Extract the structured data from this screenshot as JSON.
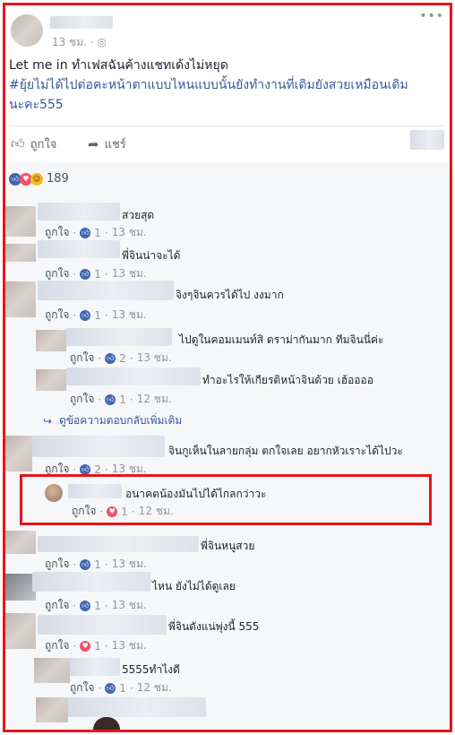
{
  "post": {
    "time": "13 ชม.",
    "privacy_icon": "globe-icon",
    "text_line1": "Let me in ทำเฟสฉันค้างแชทเด้งไม่หยุด",
    "hashtag_line": "#ยุ้ยไม่ได้ไปต่อคะหน้าตาแบบไหนแบบนั้นยังทำงานที่เดิมยังสวยเหมือนเดิม",
    "hashtag_line2": "นะคะ555",
    "like_label": "ถูกใจ",
    "share_label": "แชร์",
    "reaction_count": "189"
  },
  "comments": [
    {
      "text": "สวยสุด",
      "like": "ถูกใจ",
      "reaction": "like",
      "count": "1",
      "time": "13 ชม."
    },
    {
      "text": "พี่จินน่าจะได้",
      "like": "ถูกใจ",
      "reaction": "like",
      "count": "1",
      "time": "13 ชม."
    },
    {
      "text": "จิงๆจินควรได้ไป งงมาก",
      "like": "ถูกใจ",
      "reaction": "like",
      "count": "1",
      "time": "13 ชม."
    },
    {
      "text": "ไปดูในคอมเมนท์สิ ดราม่ากันมาก ทีมจินนี่ค่ะ",
      "like": "ถูกใจ",
      "reaction": "like",
      "count": "2",
      "time": "13 ชม."
    },
    {
      "text": "ทำอะไรให้เกียรติหน้าจินด้วย เฮ้ออออ",
      "like": "ถูกใจ",
      "reaction": "like",
      "count": "1",
      "time": "12 ชม."
    },
    {
      "text": "จินกูเห็นในลายกลุ่ม ตกใจเลย อยากหัวเราะได้ไปวะ",
      "like": "ถูกใจ",
      "reaction": "like",
      "count": "2",
      "time": "13 ชม."
    },
    {
      "text": "อนาคตน้องมันไปได้ไกลกว่าวะ",
      "like": "ถูกใจ",
      "reaction": "love",
      "count": "1",
      "time": "12 ชม."
    },
    {
      "text": "พี่จินหนูสวย",
      "like": "ถูกใจ",
      "reaction": "like",
      "count": "1",
      "time": "13 ชม."
    },
    {
      "text": "ไหน ยังไม่ได้ดูเลย",
      "like": "ถูกใจ",
      "reaction": "like",
      "count": "1",
      "time": "13 ชม."
    },
    {
      "text": "พี่จินดังแน่พุ่งนี้ 555",
      "like": "ถูกใจ",
      "reaction": "love",
      "count": "1",
      "time": "13 ชม."
    },
    {
      "text": "5555ทำไงดี",
      "like": "ถูกใจ",
      "reaction": "like",
      "count": "1",
      "time": "12 ชม."
    }
  ],
  "more_replies": "ดูข้อความตอบกลับเพิ่มเติม",
  "colors": {
    "highlight_border": "#e8141c",
    "link_blue": "#365899",
    "like_blue": "#4267b2",
    "love_red": "#f25268"
  }
}
